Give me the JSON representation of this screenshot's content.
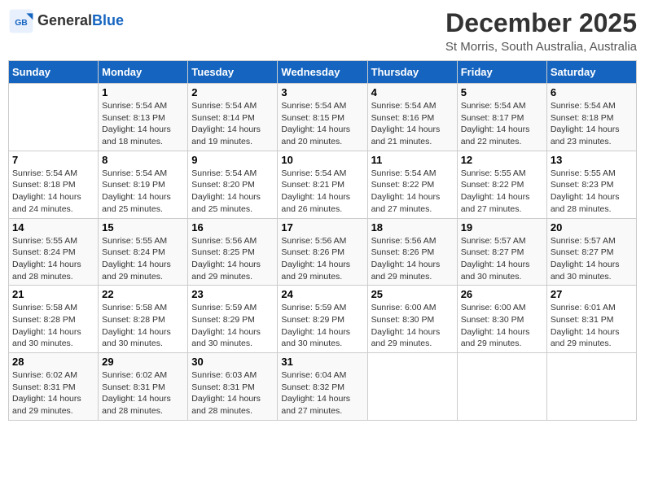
{
  "header": {
    "logo_line1": "General",
    "logo_line2": "Blue",
    "title": "December 2025",
    "subtitle": "St Morris, South Australia, Australia"
  },
  "days_of_week": [
    "Sunday",
    "Monday",
    "Tuesday",
    "Wednesday",
    "Thursday",
    "Friday",
    "Saturday"
  ],
  "weeks": [
    [
      {
        "day": "",
        "info": ""
      },
      {
        "day": "1",
        "info": "Sunrise: 5:54 AM\nSunset: 8:13 PM\nDaylight: 14 hours\nand 18 minutes."
      },
      {
        "day": "2",
        "info": "Sunrise: 5:54 AM\nSunset: 8:14 PM\nDaylight: 14 hours\nand 19 minutes."
      },
      {
        "day": "3",
        "info": "Sunrise: 5:54 AM\nSunset: 8:15 PM\nDaylight: 14 hours\nand 20 minutes."
      },
      {
        "day": "4",
        "info": "Sunrise: 5:54 AM\nSunset: 8:16 PM\nDaylight: 14 hours\nand 21 minutes."
      },
      {
        "day": "5",
        "info": "Sunrise: 5:54 AM\nSunset: 8:17 PM\nDaylight: 14 hours\nand 22 minutes."
      },
      {
        "day": "6",
        "info": "Sunrise: 5:54 AM\nSunset: 8:18 PM\nDaylight: 14 hours\nand 23 minutes."
      }
    ],
    [
      {
        "day": "7",
        "info": "Sunrise: 5:54 AM\nSunset: 8:18 PM\nDaylight: 14 hours\nand 24 minutes."
      },
      {
        "day": "8",
        "info": "Sunrise: 5:54 AM\nSunset: 8:19 PM\nDaylight: 14 hours\nand 25 minutes."
      },
      {
        "day": "9",
        "info": "Sunrise: 5:54 AM\nSunset: 8:20 PM\nDaylight: 14 hours\nand 25 minutes."
      },
      {
        "day": "10",
        "info": "Sunrise: 5:54 AM\nSunset: 8:21 PM\nDaylight: 14 hours\nand 26 minutes."
      },
      {
        "day": "11",
        "info": "Sunrise: 5:54 AM\nSunset: 8:22 PM\nDaylight: 14 hours\nand 27 minutes."
      },
      {
        "day": "12",
        "info": "Sunrise: 5:55 AM\nSunset: 8:22 PM\nDaylight: 14 hours\nand 27 minutes."
      },
      {
        "day": "13",
        "info": "Sunrise: 5:55 AM\nSunset: 8:23 PM\nDaylight: 14 hours\nand 28 minutes."
      }
    ],
    [
      {
        "day": "14",
        "info": "Sunrise: 5:55 AM\nSunset: 8:24 PM\nDaylight: 14 hours\nand 28 minutes."
      },
      {
        "day": "15",
        "info": "Sunrise: 5:55 AM\nSunset: 8:24 PM\nDaylight: 14 hours\nand 29 minutes."
      },
      {
        "day": "16",
        "info": "Sunrise: 5:56 AM\nSunset: 8:25 PM\nDaylight: 14 hours\nand 29 minutes."
      },
      {
        "day": "17",
        "info": "Sunrise: 5:56 AM\nSunset: 8:26 PM\nDaylight: 14 hours\nand 29 minutes."
      },
      {
        "day": "18",
        "info": "Sunrise: 5:56 AM\nSunset: 8:26 PM\nDaylight: 14 hours\nand 29 minutes."
      },
      {
        "day": "19",
        "info": "Sunrise: 5:57 AM\nSunset: 8:27 PM\nDaylight: 14 hours\nand 30 minutes."
      },
      {
        "day": "20",
        "info": "Sunrise: 5:57 AM\nSunset: 8:27 PM\nDaylight: 14 hours\nand 30 minutes."
      }
    ],
    [
      {
        "day": "21",
        "info": "Sunrise: 5:58 AM\nSunset: 8:28 PM\nDaylight: 14 hours\nand 30 minutes."
      },
      {
        "day": "22",
        "info": "Sunrise: 5:58 AM\nSunset: 8:28 PM\nDaylight: 14 hours\nand 30 minutes."
      },
      {
        "day": "23",
        "info": "Sunrise: 5:59 AM\nSunset: 8:29 PM\nDaylight: 14 hours\nand 30 minutes."
      },
      {
        "day": "24",
        "info": "Sunrise: 5:59 AM\nSunset: 8:29 PM\nDaylight: 14 hours\nand 30 minutes."
      },
      {
        "day": "25",
        "info": "Sunrise: 6:00 AM\nSunset: 8:30 PM\nDaylight: 14 hours\nand 29 minutes."
      },
      {
        "day": "26",
        "info": "Sunrise: 6:00 AM\nSunset: 8:30 PM\nDaylight: 14 hours\nand 29 minutes."
      },
      {
        "day": "27",
        "info": "Sunrise: 6:01 AM\nSunset: 8:31 PM\nDaylight: 14 hours\nand 29 minutes."
      }
    ],
    [
      {
        "day": "28",
        "info": "Sunrise: 6:02 AM\nSunset: 8:31 PM\nDaylight: 14 hours\nand 29 minutes."
      },
      {
        "day": "29",
        "info": "Sunrise: 6:02 AM\nSunset: 8:31 PM\nDaylight: 14 hours\nand 28 minutes."
      },
      {
        "day": "30",
        "info": "Sunrise: 6:03 AM\nSunset: 8:31 PM\nDaylight: 14 hours\nand 28 minutes."
      },
      {
        "day": "31",
        "info": "Sunrise: 6:04 AM\nSunset: 8:32 PM\nDaylight: 14 hours\nand 27 minutes."
      },
      {
        "day": "",
        "info": ""
      },
      {
        "day": "",
        "info": ""
      },
      {
        "day": "",
        "info": ""
      }
    ]
  ]
}
